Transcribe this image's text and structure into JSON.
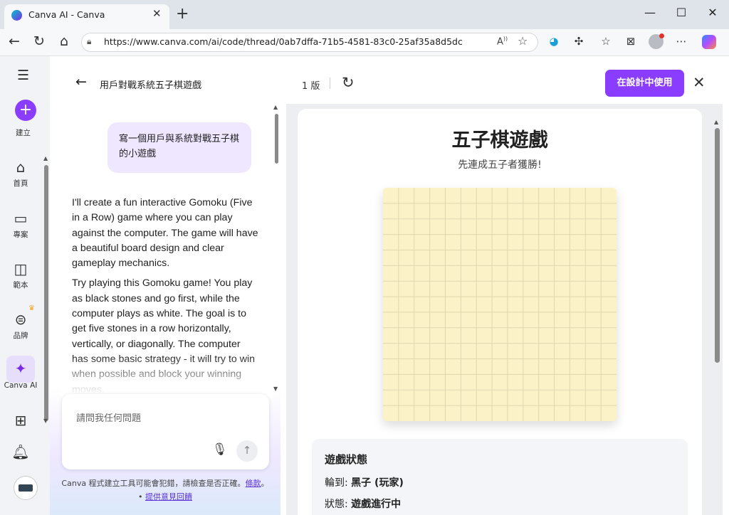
{
  "browser": {
    "tab_title": "Canva AI - Canva",
    "tab_close": "✕",
    "new_tab": "+",
    "url": "https://www.canva.com/ai/code/thread/0ab7dffa-71b5-4581-83c0-25af35a8d5dc",
    "window_minimize": "—",
    "window_maximize": "☐",
    "window_close": "✕"
  },
  "rail": {
    "menu_icon": "☰",
    "create_label": "建立",
    "home_label": "首頁",
    "projects_label": "專案",
    "templates_label": "範本",
    "brand_label": "品牌",
    "ai_label": "Canva AI"
  },
  "chat": {
    "title": "用戶對戰系統五子棋遊戲",
    "user_message": "寫一個用戶與系統對戰五子棋的小遊戲",
    "ai_paragraph_1": "I'll create a fun interactive Gomoku (Five in a Row) game where you can play against the computer. The game will have a beautiful board design and clear gameplay mechanics.",
    "ai_paragraph_2": "Try playing this Gomoku game! You play as black stones and go first, while the computer plays as white. The goal is to get five stones in a row horizontally, vertically, or diagonally. The computer has some basic strategy - it will try to win when possible and block your winning moves.",
    "input_placeholder": "請問我任何問題",
    "disclaimer_text": "Canva 程式建立工具可能會犯錯，請檢查是否正確。",
    "disclaimer_link_terms": "條款",
    "disclaimer_sep": "。 •",
    "disclaimer_link_feedback": "提供意見回饋"
  },
  "preview": {
    "version_label": "1 版",
    "use_button": "在設計中使用",
    "game_title": "五子棋遊戲",
    "game_subtitle": "先連成五子者獲勝!",
    "board_size": 15,
    "status_title": "遊戲狀態",
    "turn_label": "輪到:",
    "turn_value": "黑子 (玩家)",
    "state_label": "狀態:",
    "state_value": "遊戲進行中"
  },
  "colors": {
    "accent": "#8b3dff",
    "board_bg": "#fcf2c8",
    "board_line": "#e0d6b0"
  }
}
